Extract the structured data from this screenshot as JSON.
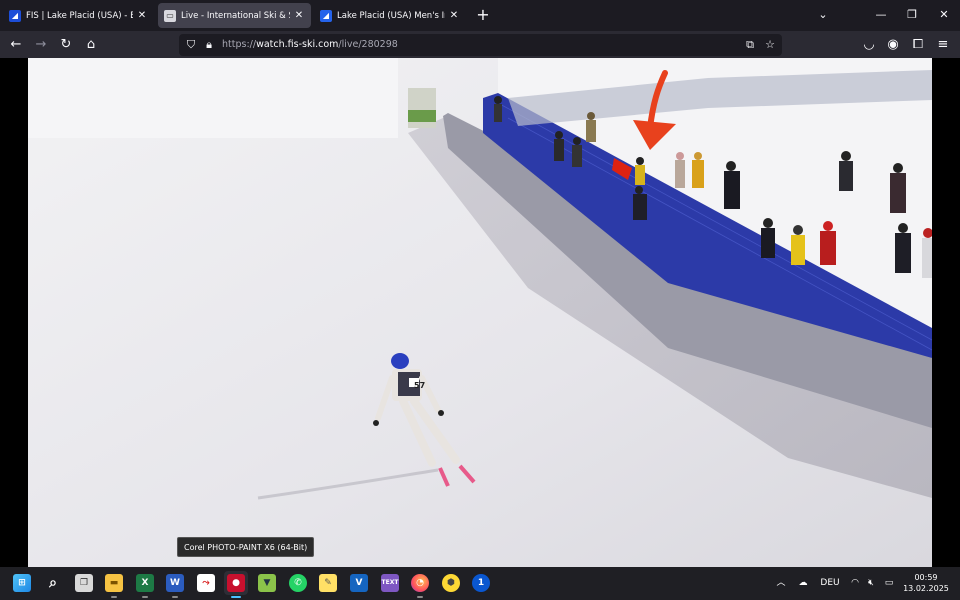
{
  "tabs": [
    {
      "title": "FIS | Lake Placid (USA) - Event Details",
      "favicon": "fis-logo-icon",
      "active": false
    },
    {
      "title": "Live - International Ski & Snowboard",
      "favicon": "page-icon",
      "active": true
    },
    {
      "title": "Lake Placid (USA) Men's Individual",
      "favicon": "fis-logo-icon",
      "active": false
    }
  ],
  "url": {
    "scheme": "https://",
    "host": "watch.fis-ski.com",
    "path": "/live/280298"
  },
  "video": {
    "bib_number": "57"
  },
  "tooltip": "Corel PHOTO-PAINT X6 (64-Bit)",
  "taskbar": {
    "apps": [
      {
        "name": "start-icon"
      },
      {
        "name": "search-icon"
      },
      {
        "name": "task-view-icon"
      },
      {
        "name": "file-explorer-icon"
      },
      {
        "name": "excel-icon"
      },
      {
        "name": "word-icon"
      },
      {
        "name": "pdf-icon"
      },
      {
        "name": "corel-photo-paint-icon"
      },
      {
        "name": "pick-icon"
      },
      {
        "name": "whatsapp-icon"
      },
      {
        "name": "sticky-notes-icon"
      },
      {
        "name": "v-app-icon"
      },
      {
        "name": "text-app-icon"
      },
      {
        "name": "firefox-icon"
      },
      {
        "name": "yellow-app-icon"
      },
      {
        "name": "onepassword-icon"
      }
    ],
    "language": "DEU",
    "time": "00:59",
    "date": "13.02.2025"
  },
  "colors": {
    "accent": "#4cc2ff",
    "fence_blue": "#2c3aa8",
    "arrow": "#e8411d"
  }
}
